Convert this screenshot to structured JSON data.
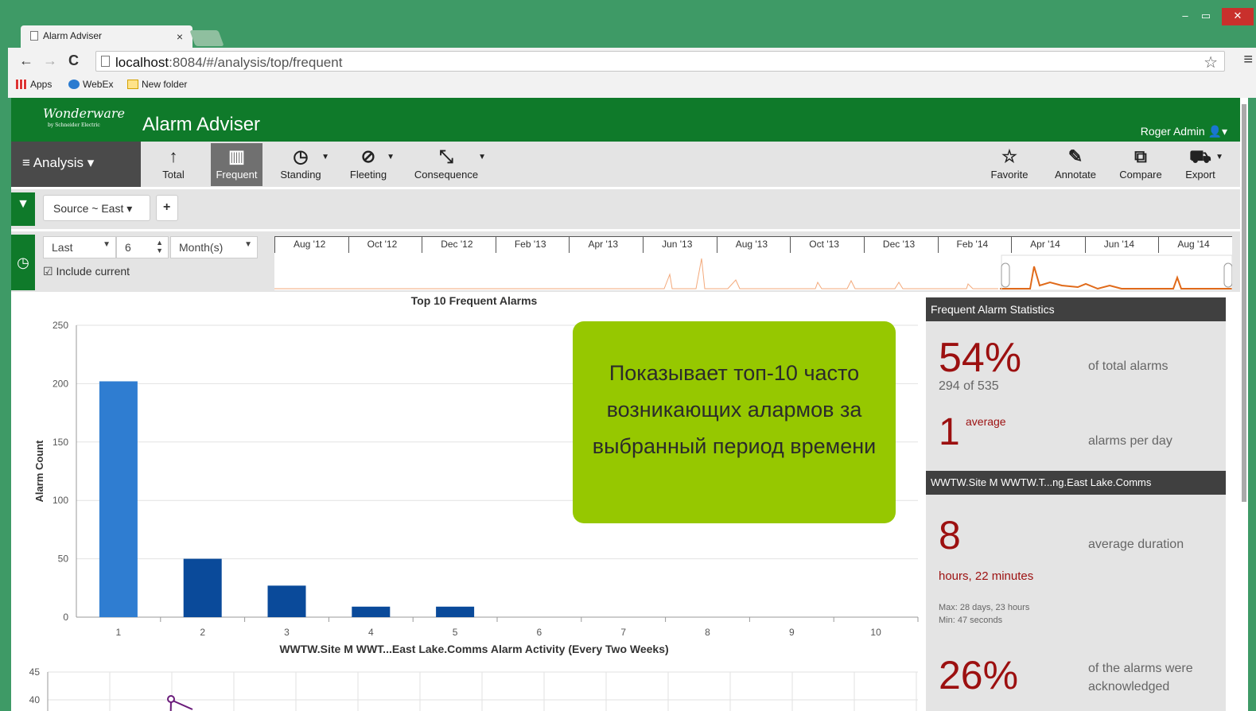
{
  "browser": {
    "tab_title": "Alarm Adviser",
    "tab_close": "×",
    "url_host": "localhost",
    "url_path": ":8084/#/analysis/top/frequent",
    "bookmarks": [
      "Apps",
      "WebEx",
      "New folder"
    ],
    "window_controls": [
      "‒",
      "▭",
      "✕"
    ]
  },
  "app": {
    "logo": "Wonderware",
    "logo_sub": "by Schneider Electric",
    "title": "Alarm Adviser",
    "user": "Roger Admin",
    "analysis_label": "Analysis"
  },
  "toolbar": {
    "buttons": [
      {
        "label": "Total",
        "icon": "↑"
      },
      {
        "label": "Frequent",
        "icon": "▥"
      },
      {
        "label": "Standing",
        "icon": "◷"
      },
      {
        "label": "Fleeting",
        "icon": "⊘"
      },
      {
        "label": "Consequence",
        "icon": "⤡"
      }
    ],
    "right_buttons": [
      {
        "label": "Favorite",
        "icon": "☆"
      },
      {
        "label": "Annotate",
        "icon": "✎"
      },
      {
        "label": "Compare",
        "icon": "⧉"
      },
      {
        "label": "Export",
        "icon": "⛟"
      }
    ]
  },
  "filter": {
    "chip": "Source ~ East",
    "add": "+"
  },
  "time": {
    "mode": "Last",
    "count": "6",
    "unit": "Month(s)",
    "include_current": "Include current",
    "months": [
      "Aug '12",
      "Oct '12",
      "Dec '12",
      "Feb '13",
      "Apr '13",
      "Jun '13",
      "Aug '13",
      "Oct '13",
      "Dec '13",
      "Feb '14",
      "Apr '14",
      "Jun '14",
      "Aug '14"
    ]
  },
  "overlay_text": "Показывает топ-10 часто возникающих алармов за выбранный период времени",
  "chart_data": [
    {
      "type": "bar",
      "title": "Top 10 Frequent Alarms",
      "ylabel": "Alarm Count",
      "xlabel": "",
      "categories": [
        "1",
        "2",
        "3",
        "4",
        "5",
        "6",
        "7",
        "8",
        "9",
        "10"
      ],
      "values": [
        202,
        50,
        27,
        9,
        9,
        0,
        0,
        0,
        0,
        0
      ],
      "ylim": [
        0,
        250
      ],
      "yticks": [
        0,
        50,
        100,
        150,
        200,
        250
      ],
      "colors": {
        "highlight": "#2f7dd1",
        "default": "#0a4a9a"
      }
    },
    {
      "type": "line",
      "title": "WWTW.Site M WWT...East Lake.Comms Alarm Activity (Every Two Weeks)",
      "yticks_visible": [
        45,
        40
      ],
      "ylim": [
        38,
        45
      ]
    }
  ],
  "stats": {
    "header1": "Frequent Alarm Statistics",
    "pct": "54%",
    "pct_label": "of total alarms",
    "pct_sub": "294 of 535",
    "avg_value": "1",
    "avg_super": "average",
    "avg_label": "alarms per day",
    "header2": "WWTW.Site M WWTW.T...ng.East Lake.Comms",
    "dur_value": "8",
    "dur_label": "average duration",
    "dur_sub": "hours, 22 minutes",
    "dur_max": "Max: 28 days, 23 hours",
    "dur_min": "Min: 47 seconds",
    "ack_pct": "26%",
    "ack_label1": "of the alarms were",
    "ack_label2": "acknowledged"
  }
}
